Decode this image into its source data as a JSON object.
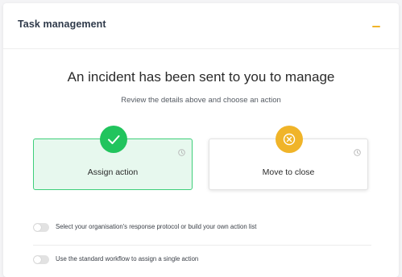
{
  "card": {
    "title": "Task management",
    "collapse_icon": "minus-icon"
  },
  "main": {
    "heading": "An incident has been sent to you to manage",
    "subheading": "Review the details above and choose an action"
  },
  "options": [
    {
      "label": "Assign action",
      "icon": "check-icon",
      "info_icon": "clock-icon",
      "color": "#21c45d",
      "selected": true
    },
    {
      "label": "Move to close",
      "icon": "close-circle-icon",
      "info_icon": "clock-icon",
      "color": "#f0b429",
      "selected": false
    }
  ],
  "toggles": [
    {
      "label": "Select your organisation's response protocol or build your own action list",
      "on": false
    },
    {
      "label": "Use the standard workflow to assign a single action",
      "on": false
    }
  ],
  "colors": {
    "accent": "#f0b429",
    "success": "#21c45d",
    "selected_bg": "#e7f8ee",
    "selected_border": "#3ecf7a"
  }
}
